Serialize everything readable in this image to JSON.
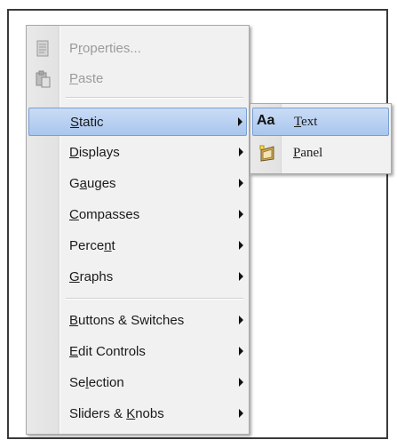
{
  "menu": {
    "items": [
      {
        "label": "Properties...",
        "mnemonic": "r",
        "enabled": false,
        "icon": "properties-icon"
      },
      {
        "label": "Paste",
        "mnemonic": "P",
        "enabled": false,
        "icon": "paste-icon"
      },
      {
        "label": "Static",
        "mnemonic": "S",
        "submenu": true,
        "active": true
      },
      {
        "label": "Displays",
        "mnemonic": "D",
        "submenu": true
      },
      {
        "label": "Gauges",
        "mnemonic": "a",
        "submenu": true
      },
      {
        "label": "Compasses",
        "mnemonic": "C",
        "submenu": true
      },
      {
        "label": "Percent",
        "mnemonic": "n",
        "submenu": true
      },
      {
        "label": "Graphs",
        "mnemonic": "G",
        "submenu": true
      },
      {
        "label": "Buttons & Switches",
        "mnemonic": "B",
        "submenu": true
      },
      {
        "label": "Edit Controls",
        "mnemonic": "E",
        "submenu": true
      },
      {
        "label": "Selection",
        "mnemonic": "l",
        "submenu": true
      },
      {
        "label": "Sliders & Knobs",
        "mnemonic": "K",
        "submenu": true
      }
    ]
  },
  "submenu": {
    "items": [
      {
        "label": "Text",
        "mnemonic": "T",
        "icon": "text-aa-icon",
        "icon_text": "Aa",
        "active": true
      },
      {
        "label": "Panel",
        "mnemonic": "P",
        "icon": "panel-icon"
      }
    ]
  },
  "colors": {
    "highlight": "#b7d0f2",
    "highlight_border": "#7a9fd3"
  }
}
